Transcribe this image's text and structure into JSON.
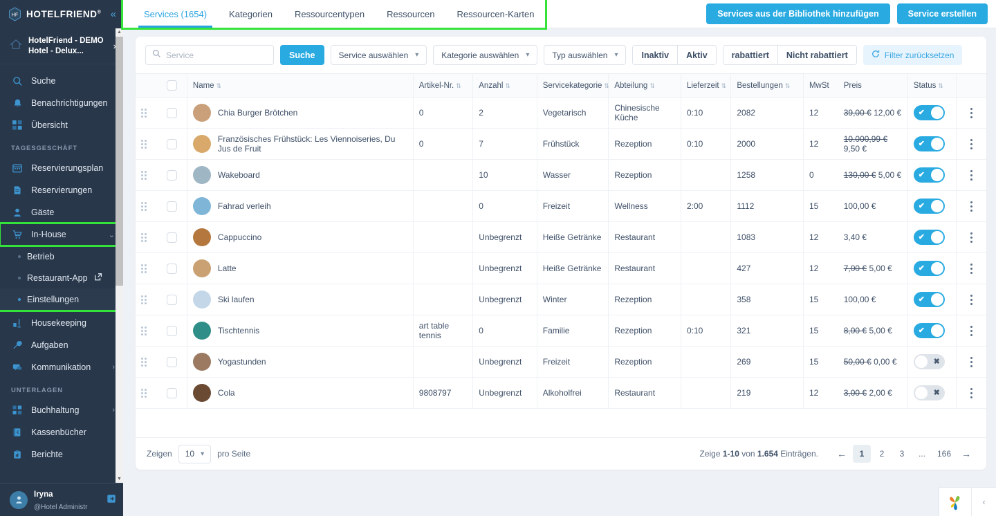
{
  "sidebar": {
    "brand": {
      "name": "HOTELFRIEND",
      "registered": "®",
      "collapse_icon": "«"
    },
    "hotel": {
      "line1": "HotelFriend - DEMO",
      "line2": "Hotel - Delux...",
      "chevron": "›"
    },
    "items": [
      {
        "label": "Suche",
        "icon": "search-icon"
      },
      {
        "label": "Benachrichtigungen",
        "icon": "bell-icon"
      },
      {
        "label": "Übersicht",
        "icon": "grid-icon"
      }
    ],
    "section_tagesgeschaeft": "TAGESGESCHÄFT",
    "tagesgeschaeft_items": [
      {
        "label": "Reservierungsplan",
        "icon": "calendar-icon"
      },
      {
        "label": "Reservierungen",
        "icon": "document-icon"
      },
      {
        "label": "Gäste",
        "icon": "user-icon"
      },
      {
        "label": "In-House",
        "icon": "cart-icon",
        "chevron": "⌄",
        "expanded": true
      }
    ],
    "inhouse_children": [
      {
        "label": "Betrieb"
      },
      {
        "label": "Restaurant-App",
        "external_icon": "↗"
      },
      {
        "label": "Einstellungen",
        "active": true
      }
    ],
    "after_inhouse_items": [
      {
        "label": "Housekeeping",
        "icon": "broom-icon"
      },
      {
        "label": "Aufgaben",
        "icon": "tools-icon"
      },
      {
        "label": "Kommunikation",
        "icon": "chat-icon",
        "chevron": "›"
      }
    ],
    "section_unterlagen": "UNTERLAGEN",
    "unterlagen_items": [
      {
        "label": "Buchhaltung",
        "icon": "blocks-icon",
        "chevron": "›"
      },
      {
        "label": "Kassenbücher",
        "icon": "book-icon"
      },
      {
        "label": "Berichte",
        "icon": "clipboard-icon"
      }
    ],
    "user": {
      "name": "Iryna",
      "role": "@Hotel Administr",
      "logout_icon": "logout-icon"
    }
  },
  "topbar": {
    "tabs": [
      {
        "label": "Services (1654)",
        "active": true
      },
      {
        "label": "Kategorien",
        "active": false
      },
      {
        "label": "Ressourcentypen",
        "active": false
      },
      {
        "label": "Ressourcen",
        "active": false
      },
      {
        "label": "Ressourcen-Karten",
        "active": false
      }
    ],
    "add_from_library_label": "Services aus der Bibliothek hinzufügen",
    "create_service_label": "Service erstellen"
  },
  "filters": {
    "search_placeholder": "Service",
    "search_value": "",
    "search_icon": "search-icon",
    "search_button": "Suche",
    "service_select": "Service auswählen",
    "category_select": "Kategorie auswählen",
    "type_select": "Typ auswählen",
    "segment_status": [
      "Inaktiv",
      "Aktiv"
    ],
    "segment_discount": [
      "rabattiert",
      "Nicht rabattiert"
    ],
    "reset_label": "Filter zurücksetzen",
    "reset_icon": "refresh-icon"
  },
  "table": {
    "columns": [
      {
        "label": "Name",
        "sortable": true
      },
      {
        "label": "Artikel-Nr.",
        "sortable": true
      },
      {
        "label": "Anzahl",
        "sortable": true
      },
      {
        "label": "Servicekategorie",
        "sortable": true
      },
      {
        "label": "Abteilung",
        "sortable": true
      },
      {
        "label": "Lieferzeit",
        "sortable": true
      },
      {
        "label": "Bestellungen",
        "sortable": true
      },
      {
        "label": "MwSt",
        "sortable": false
      },
      {
        "label": "Preis",
        "sortable": false
      },
      {
        "label": "Status",
        "sortable": true
      }
    ],
    "sort_icon": "sort-icon",
    "rows": [
      {
        "name": "Chia Burger Brötchen",
        "artikel": "0",
        "anzahl": "2",
        "kategorie": "Vegetarisch",
        "abteilung": "Chinesische Küche",
        "lieferzeit": "0:10",
        "bestellungen": "2082",
        "mwst": "12",
        "price_old": "39,00 €",
        "price_new": "12,00 €",
        "status_on": true,
        "thumb": "#c9a07a"
      },
      {
        "name": "Französisches Frühstück: Les Viennoiseries, Du Jus de Fruit",
        "artikel": "0",
        "anzahl": "7",
        "kategorie": "Frühstück",
        "abteilung": "Rezeption",
        "lieferzeit": "0:10",
        "bestellungen": "2000",
        "mwst": "12",
        "price_old": "10.000,99 €",
        "price_new": "9,50 €",
        "status_on": true,
        "thumb": "#d8a96b"
      },
      {
        "name": "Wakeboard",
        "artikel": "",
        "anzahl": "10",
        "kategorie": "Wasser",
        "abteilung": "Rezeption",
        "lieferzeit": "",
        "bestellungen": "1258",
        "mwst": "0",
        "price_old": "130,00 €",
        "price_new": "5,00 €",
        "status_on": true,
        "thumb": "#9fb6c4"
      },
      {
        "name": "Fahrad verleih",
        "artikel": "",
        "anzahl": "0",
        "kategorie": "Freizeit",
        "abteilung": "Wellness",
        "lieferzeit": "2:00",
        "bestellungen": "1112",
        "mwst": "15",
        "price_old": "",
        "price_new": "100,00 €",
        "status_on": true,
        "thumb": "#7fb6d8"
      },
      {
        "name": "Cappuccino",
        "artikel": "",
        "anzahl": "Unbegrenzt",
        "kategorie": "Heiße Getränke",
        "abteilung": "Restaurant",
        "lieferzeit": "",
        "bestellungen": "1083",
        "mwst": "12",
        "price_old": "",
        "price_new": "3,40 €",
        "status_on": true,
        "thumb": "#b4783f"
      },
      {
        "name": "Latte",
        "artikel": "",
        "anzahl": "Unbegrenzt",
        "kategorie": "Heiße Getränke",
        "abteilung": "Restaurant",
        "lieferzeit": "",
        "bestellungen": "427",
        "mwst": "12",
        "price_old": "7,00 €",
        "price_new": "5,00 €",
        "status_on": true,
        "thumb": "#caa173"
      },
      {
        "name": "Ski laufen",
        "artikel": "",
        "anzahl": "Unbegrenzt",
        "kategorie": "Winter",
        "abteilung": "Rezeption",
        "lieferzeit": "",
        "bestellungen": "358",
        "mwst": "15",
        "price_old": "",
        "price_new": "100,00 €",
        "status_on": true,
        "thumb": "#c3d7e8"
      },
      {
        "name": "Tischtennis",
        "artikel": "art table tennis",
        "anzahl": "0",
        "kategorie": "Familie",
        "abteilung": "Rezeption",
        "lieferzeit": "0:10",
        "bestellungen": "321",
        "mwst": "15",
        "price_old": "8,00 €",
        "price_new": "5,00 €",
        "status_on": true,
        "thumb": "#2f8e87"
      },
      {
        "name": "Yogastunden",
        "artikel": "",
        "anzahl": "Unbegrenzt",
        "kategorie": "Freizeit",
        "abteilung": "Rezeption",
        "lieferzeit": "",
        "bestellungen": "269",
        "mwst": "15",
        "price_old": "50,00 €",
        "price_new": "0,00 €",
        "status_on": false,
        "thumb": "#9c7a62"
      },
      {
        "name": "Cola",
        "artikel": "9808797",
        "anzahl": "Unbegrenzt",
        "kategorie": "Alkoholfrei",
        "abteilung": "Restaurant",
        "lieferzeit": "",
        "bestellungen": "219",
        "mwst": "12",
        "price_old": "3,00 €",
        "price_new": "2,00 €",
        "status_on": false,
        "thumb": "#6b4a34"
      }
    ]
  },
  "footer": {
    "show_label": "Zeigen",
    "per_page_value": "10",
    "per_page_label": "pro Seite",
    "info_prefix": "Zeige ",
    "info_range": "1-10",
    "info_mid": " von ",
    "info_total": "1.654",
    "info_suffix": " Einträgen.",
    "prev_arrow": "←",
    "next_arrow": "→",
    "pages": [
      "1",
      "2",
      "3",
      "...",
      "166"
    ],
    "current_page": "1"
  },
  "widget": {
    "logo": "flower-logo",
    "close_icon": "‹"
  },
  "colors": {
    "accent": "#29ABE2",
    "sidebar": "#28374a",
    "highlight": "#33e33a",
    "page_bg": "#eef1f5"
  }
}
